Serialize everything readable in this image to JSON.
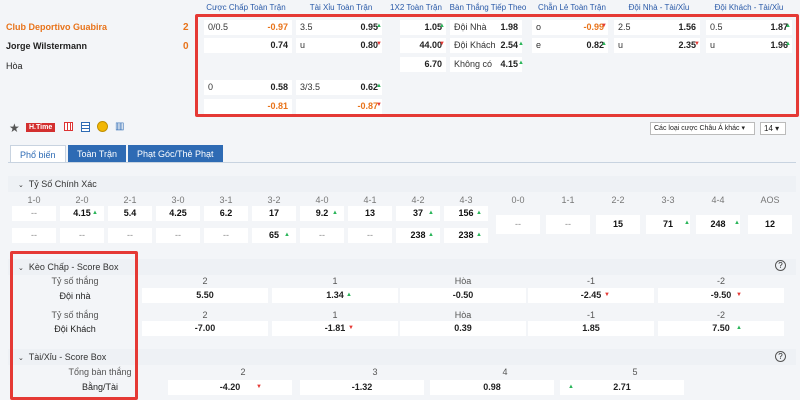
{
  "match": {
    "home": "Club Deportivo Guabira",
    "home_score": "2",
    "away": "Jorge Wilstermann",
    "away_score": "0",
    "draw": "Hòa"
  },
  "odds_headers": [
    "Cược Chấp Toàn Trận",
    "Tài Xỉu Toàn Trận",
    "1X2 Toàn Trận",
    "Bàn Thắng Tiếp Theo",
    "Chẵn Lẻ Toàn Trận",
    "Đội Nhà - Tài/Xỉu",
    "Đội Khách - Tài/Xỉu"
  ],
  "odds": {
    "hcap_r1_l": "0/0.5",
    "hcap_r1_v": "-0.97",
    "hcap_r2_v": "0.74",
    "ou_r1_l": "3.5",
    "ou_r1_v": "0.95",
    "ou_r2_l": "u",
    "ou_r2_v": "0.80",
    "x12_1": "1.05",
    "x12_2": "44.00",
    "x12_3": "6.70",
    "ng_1_l": "Đội Nhà",
    "ng_1_v": "1.98",
    "ng_2_l": "Đội Khách",
    "ng_2_v": "2.54",
    "ng_3_l": "Không có",
    "ng_3_v": "4.15",
    "oe_1_l": "o",
    "oe_1_v": "-0.99",
    "oe_2_l": "e",
    "oe_2_v": "0.82",
    "hou_1_l": "2.5",
    "hou_1_v": "1.56",
    "hou_2_l": "u",
    "hou_2_v": "2.35",
    "aou_1_l": "0.5",
    "aou_1_v": "1.87",
    "aou_2_l": "u",
    "aou_2_v": "1.96",
    "hcap2_r1_l": "0",
    "hcap2_r1_v": "0.58",
    "hcap2_r2_v": "-0.81",
    "ou2_r1_l": "3/3.5",
    "ou2_r1_v": "0.62",
    "ou2_r2_v": "-0.87"
  },
  "toolbar": {
    "htime": "H.Time",
    "select": "Các loại cược Châu Á khác",
    "num": "14"
  },
  "tabs": [
    "Phổ biến",
    "Toàn Trận",
    "Phạt Góc/Thẻ Phạt"
  ],
  "correct_score": {
    "title": "Tỷ Số Chính Xác",
    "headers": [
      "1-0",
      "2-0",
      "2-1",
      "3-0",
      "3-1",
      "3-2",
      "4-0",
      "4-1",
      "4-2",
      "4-3",
      "0-0",
      "1-1",
      "2-2",
      "3-3",
      "4-4",
      "AOS"
    ],
    "row1": [
      "--",
      "4.15",
      "5.4",
      "4.25",
      "6.2",
      "17",
      "9.2",
      "13",
      "37",
      "156"
    ],
    "row2": [
      "--",
      "--",
      "--",
      "--",
      "--",
      "65",
      "--",
      "--",
      "238",
      "238"
    ],
    "right": [
      "--",
      "--",
      "15",
      "71",
      "248",
      "12"
    ]
  },
  "hcap_box": {
    "title": "Kèo Chấp - Score Box",
    "label1": "Tỷ số thắng",
    "team1": "Đội nhà",
    "label2": "Tỷ số thắng",
    "team2": "Đội Khách",
    "cols": [
      "2",
      "1",
      "Hòa",
      "-1",
      "-2"
    ],
    "home_vals": [
      "5.50",
      "1.34",
      "-0.50",
      "-2.45",
      "-9.50"
    ],
    "away_vals": [
      "-7.00",
      "-1.81",
      "0.39",
      "1.85",
      "7.50"
    ]
  },
  "ou_box": {
    "title": "Tài/Xỉu - Score Box",
    "label": "Tổng bàn thắng",
    "row": "Bằng/Tài",
    "cols": [
      "2",
      "3",
      "4",
      "5"
    ],
    "vals": [
      "-4.20",
      "-1.32",
      "0.98",
      "2.71"
    ]
  }
}
